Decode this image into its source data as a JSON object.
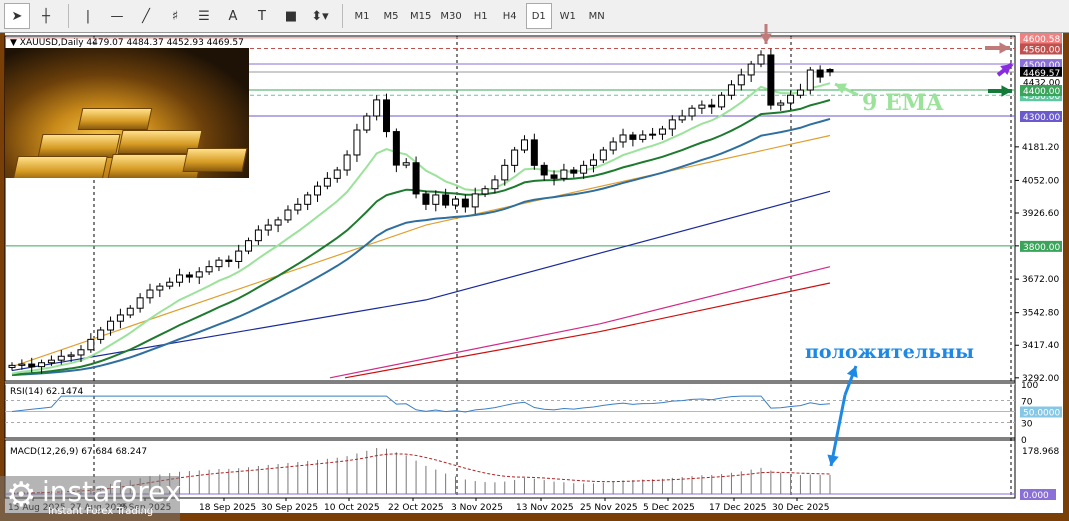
{
  "toolbar": {
    "tools": [
      {
        "name": "cursor-icon",
        "glyph": "➤"
      },
      {
        "name": "crosshair-icon",
        "glyph": "┼"
      },
      {
        "name": "vertical-line-icon",
        "glyph": "|"
      },
      {
        "name": "horizontal-line-icon",
        "glyph": "—"
      },
      {
        "name": "trendline-icon",
        "glyph": "╱"
      },
      {
        "name": "fibonacci-channel-icon",
        "glyph": "♯"
      },
      {
        "name": "fibonacci-icon",
        "glyph": "☰"
      },
      {
        "name": "text-icon",
        "glyph": "A"
      },
      {
        "name": "text-label-icon",
        "glyph": "T"
      },
      {
        "name": "rectangle-icon",
        "glyph": "■"
      },
      {
        "name": "arrows-icon",
        "glyph": "⬍▾"
      }
    ],
    "timeframes": [
      "M1",
      "M5",
      "M15",
      "M30",
      "H1",
      "H4",
      "D1",
      "W1",
      "MN"
    ],
    "active_timeframe": "D1"
  },
  "chart": {
    "symbol_info": "▼ XAUUSD,Daily  4479.07 4484.37 4452.93 4469.57",
    "price_axis": [
      "4181.20",
      "4052.00",
      "3926.60",
      "3800.00",
      "3672.00",
      "3542.80",
      "3417.40",
      "3292.00"
    ],
    "price_axis_values": [
      4181.2,
      4052,
      3926.6,
      3800,
      3672,
      3542.8,
      3417.4,
      3292
    ],
    "levels": [
      {
        "label": "4600.58",
        "value": 4600.58,
        "color": "#f08080",
        "style": "solid"
      },
      {
        "label": "4560.00",
        "value": 4560,
        "color": "#c0504d",
        "style": "dashed"
      },
      {
        "label": "4500.00",
        "value": 4500,
        "color": "#8a6fd6",
        "style": "solid"
      },
      {
        "label": "4469.57",
        "value": 4469.57,
        "color": "#000000",
        "style": "solid"
      },
      {
        "label": "4432.00",
        "value": 4432,
        "color": "#ffffff",
        "style": "none"
      },
      {
        "label": "4380.00",
        "value": 4380,
        "color": "#5fc7a0",
        "style": "dashed"
      },
      {
        "label": "4400.00",
        "value": 4400,
        "color": "#3aa55a",
        "style": "solid"
      },
      {
        "label": "4300.00",
        "value": 4300,
        "color": "#6a5acd",
        "style": "solid"
      },
      {
        "label": "3800.00",
        "value": 3800,
        "color": "#3aa55a",
        "style": "solid"
      }
    ],
    "dates": [
      "15 Aug 2025",
      "27 Aug 2025",
      "8 Sep 2025",
      "18 Sep 2025",
      "30 Sep 2025",
      "10 Oct 2025",
      "22 Oct 2025",
      "3 Nov 2025",
      "13 Nov 2025",
      "25 Nov 2025",
      "5 Dec 2025",
      "17 Dec 2025",
      "30 Dec 2025"
    ],
    "annotation_ema": "9 EMA",
    "annotation_positive": "положительны",
    "rsi": {
      "label": "RSI(14) 62.1474",
      "levels": [
        "100",
        "70",
        "50.0000",
        "30",
        "0"
      ]
    },
    "macd": {
      "label": "MACD(12,26,9) 67.684 68.247",
      "max": "178.968",
      "zero": "0.000"
    },
    "watermark": {
      "brand": "instaforex",
      "tagline": "Instant Forex Trading"
    }
  },
  "chart_data": {
    "type": "candlestick",
    "symbol": "XAUUSD",
    "timeframe": "Daily",
    "ylim": [
      3292,
      4600.58
    ],
    "closes": [
      3340,
      3345,
      3335,
      3350,
      3360,
      3375,
      3380,
      3400,
      3440,
      3476,
      3510,
      3534,
      3560,
      3600,
      3630,
      3645,
      3660,
      3688,
      3680,
      3700,
      3720,
      3745,
      3740,
      3780,
      3820,
      3861,
      3880,
      3900,
      3938,
      3960,
      3996,
      4030,
      4060,
      4092,
      4150,
      4246,
      4300,
      4362,
      4240,
      4111,
      4120,
      4000,
      3960,
      3996,
      3957,
      3980,
      3950,
      4000,
      4020,
      4054,
      4110,
      4169,
      4208,
      4110,
      4073,
      4060,
      4092,
      4080,
      4110,
      4131,
      4169,
      4200,
      4227,
      4210,
      4227,
      4230,
      4250,
      4285,
      4300,
      4330,
      4342,
      4335,
      4380,
      4420,
      4458,
      4500,
      4535,
      4342,
      4350,
      4380,
      4400,
      4477,
      4450,
      4469.57
    ],
    "last_ohlc": {
      "open": 4479.07,
      "high": 4484.37,
      "low": 4452.93,
      "close": 4469.57
    },
    "ema_periods": [
      9,
      21,
      34
    ],
    "long_ma_lines": [
      {
        "color": "#e0a030",
        "values": [
          3335,
          3880,
          4225
        ]
      },
      {
        "color": "#1a2a9a",
        "values": [
          3320,
          3592,
          4010
        ]
      },
      {
        "color": "#d02a8a",
        "values": [
          3292,
          3500,
          3720
        ]
      },
      {
        "color": "#cc1111",
        "values": [
          3292,
          3470,
          3657
        ]
      }
    ],
    "rsi_value": 62.1474,
    "macd_values": {
      "main": 67.684,
      "signal": 68.247
    }
  }
}
